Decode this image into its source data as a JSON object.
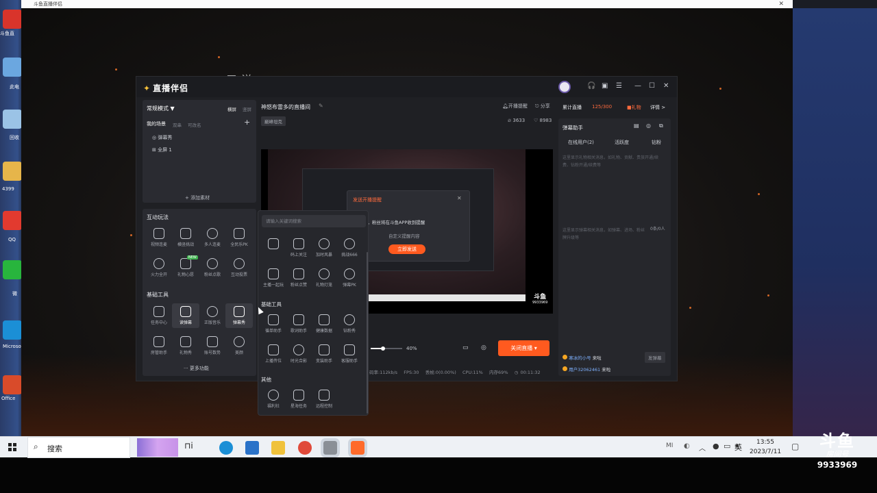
{
  "browser": {
    "title": "斗鱼直播伴侣"
  },
  "desktop": {
    "labels": [
      "斗鱼直",
      "此电",
      "回收",
      "4399",
      "QQ",
      "微",
      "Microsoft Ed",
      "Office"
    ]
  },
  "overlay_text": "三说",
  "app": {
    "logo": "直播伴侣",
    "left": {
      "mode": "常规模式 ▼",
      "orient_h": "横屏",
      "orient_v": "竖屏",
      "scene_title": "我的场景",
      "scene_tab2": "双串",
      "scene_tab3": "可改名",
      "scene_items": [
        "弹幕秀",
        "全屏 1"
      ],
      "add_material": "+ 添加素材"
    },
    "interactive": {
      "title": "互动玩法",
      "tools": [
        "视频连麦",
        "横竖挑战",
        "多人连麦",
        "全民乐PK",
        "火力全开",
        "礼物心愿",
        "粉丝点歌",
        "互动投票"
      ],
      "badge": "NEW"
    },
    "basic": {
      "title": "基础工具",
      "tools": [
        "任务中心",
        "读弹幕",
        "正版音乐",
        "弹幕秀",
        "房管助手",
        "礼物秀",
        "账号数势",
        "美颜"
      ]
    },
    "more": "··· 更多功能",
    "stream": {
      "title": "神怒布雷多的直播间",
      "tag": "巅峰坦克",
      "notify": "开播提醒",
      "share": "分享",
      "viewers": "3633",
      "likes": "8983"
    },
    "dialog": {
      "title": "发送开播提醒",
      "body": "送三次，粉丝将在斗鱼APP收到提醒",
      "sub": "自定义提醒内容",
      "button": "立即发送"
    },
    "preview_room": "9933969",
    "controls": {
      "volume": "40%",
      "live_button": "关闭直播"
    },
    "status": {
      "bitrate": "码率:112kb/s",
      "fps": "FPS:30",
      "drop": "丢帧:0(0.00%)",
      "cpu": "CPU:11%",
      "mem": "内存69%",
      "time": "00:11:32"
    },
    "right": {
      "cum_label": "累计直播",
      "cum_value": "125/300",
      "gift_tag": "礼物",
      "detail": "详情 >",
      "assistant": "弹幕助手",
      "tabs": [
        "在线用户(2)",
        "活跃度",
        "钻粉"
      ],
      "hint1": "这里显示礼物相关消息，如礼物、贡献、贵族开通/续费、钻粉开通/续费等",
      "hint2": "这里显示弹幕相关消息，如弹幕、进场、粉丝牌升级等",
      "rate": "0条/0人",
      "msgs": [
        {
          "user": "寒冰的小号",
          "action": "来啦"
        },
        {
          "user": "用户32062461",
          "action": "来啦"
        }
      ],
      "send": "发弹幕"
    }
  },
  "popup": {
    "search_placeholder": "请输入关键词搜索",
    "row1": [
      "",
      "码上关注",
      "加时风暴",
      "挑战666"
    ],
    "row2": [
      "主播一起玩",
      "粉丝点赞",
      "礼物灯笼",
      "弹幕PK"
    ],
    "section2": "基础工具",
    "row3": [
      "循单助手",
      "歌词助手",
      "健康数据",
      "钻粉秀"
    ],
    "row4": [
      "上播传位",
      "时光合影",
      "变装助手",
      "客服助手"
    ],
    "section3": "其他",
    "row5": [
      "福利社",
      "星海任务",
      "远程控制"
    ]
  },
  "taskbar": {
    "search": "搜索",
    "clock_time": "13:55",
    "clock_date": "2023/7/11",
    "ime": "英"
  },
  "watermark": {
    "brand": "斗鱼",
    "label": "房间号",
    "room": "9933969"
  }
}
